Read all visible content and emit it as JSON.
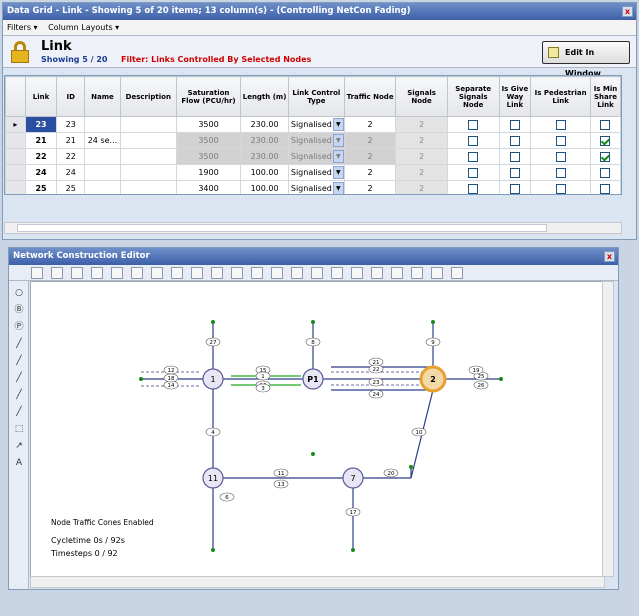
{
  "grid_window": {
    "title": "Data Grid - Link - Showing 5 of 20 items;  13 column(s) - (Controlling NetCon Fading)",
    "close_label": "x",
    "menu": [
      "Filters ▾",
      "Column Layouts ▾"
    ],
    "heading": "Link",
    "showing": "Showing 5 / 20",
    "filter_text": "Filter:  Links Controlled By Selected Nodes",
    "edit_button": "Edit In Window",
    "columns": [
      "Link",
      "ID",
      "Name",
      "Description",
      "Saturation Flow (PCU/hr)",
      "Length (m)",
      "Link Control Type",
      "Traffic Node",
      "Signals Node",
      "Separate Signals Node",
      "Is Give Way Link",
      "Is Pedestrian Link",
      "Is Min Share Link"
    ],
    "rows": [
      {
        "link": "23",
        "id": "23",
        "name": "",
        "desc": "",
        "sat": "3500",
        "len": "230.00",
        "ctrl": "Signalised",
        "traffic": "2",
        "signals": "2",
        "sep": false,
        "giveway": false,
        "ped": false,
        "minshare": false,
        "grey": false
      },
      {
        "link": "21",
        "id": "21",
        "name": "24 se...",
        "desc": "",
        "sat": "3500",
        "len": "230.00",
        "ctrl": "Signalised",
        "traffic": "2",
        "signals": "2",
        "sep": false,
        "giveway": false,
        "ped": false,
        "minshare": true,
        "grey": true
      },
      {
        "link": "22",
        "id": "22",
        "name": "",
        "desc": "",
        "sat": "3500",
        "len": "230.00",
        "ctrl": "Signalised",
        "traffic": "2",
        "signals": "2",
        "sep": false,
        "giveway": false,
        "ped": false,
        "minshare": true,
        "grey": true
      },
      {
        "link": "24",
        "id": "24",
        "name": "",
        "desc": "",
        "sat": "1900",
        "len": "100.00",
        "ctrl": "Signalised",
        "traffic": "2",
        "signals": "2",
        "sep": false,
        "giveway": false,
        "ped": false,
        "minshare": false,
        "grey": false
      },
      {
        "link": "25",
        "id": "25",
        "name": "",
        "desc": "",
        "sat": "3400",
        "len": "100.00",
        "ctrl": "Signalised",
        "traffic": "2",
        "signals": "2",
        "sep": false,
        "giveway": false,
        "ped": false,
        "minshare": false,
        "grey": false
      }
    ]
  },
  "network_window": {
    "title": "Network Construction Editor",
    "close_label": "x",
    "status_cones": "Node Traffic Cones Enabled",
    "cycletime": "Cycletime 0s / 92s",
    "timesteps": "Timesteps 0 / 92",
    "nodes": [
      {
        "label": "1"
      },
      {
        "label": "P1"
      },
      {
        "label": "2"
      },
      {
        "label": "11"
      },
      {
        "label": "7"
      }
    ],
    "link_labels": [
      "12",
      "14",
      "15",
      "16",
      "1",
      "3",
      "21",
      "22",
      "23",
      "24",
      "25",
      "26",
      "27",
      "4",
      "6",
      "8",
      "9",
      "10",
      "11",
      "13",
      "17",
      "18",
      "19",
      "20"
    ]
  },
  "colors": {
    "title_bar": "#3d5fa8",
    "selected_row": "#2a4fa0",
    "filter_red": "#d00000",
    "node_highlight": "#e8a030",
    "link_green": "#22aa22"
  }
}
